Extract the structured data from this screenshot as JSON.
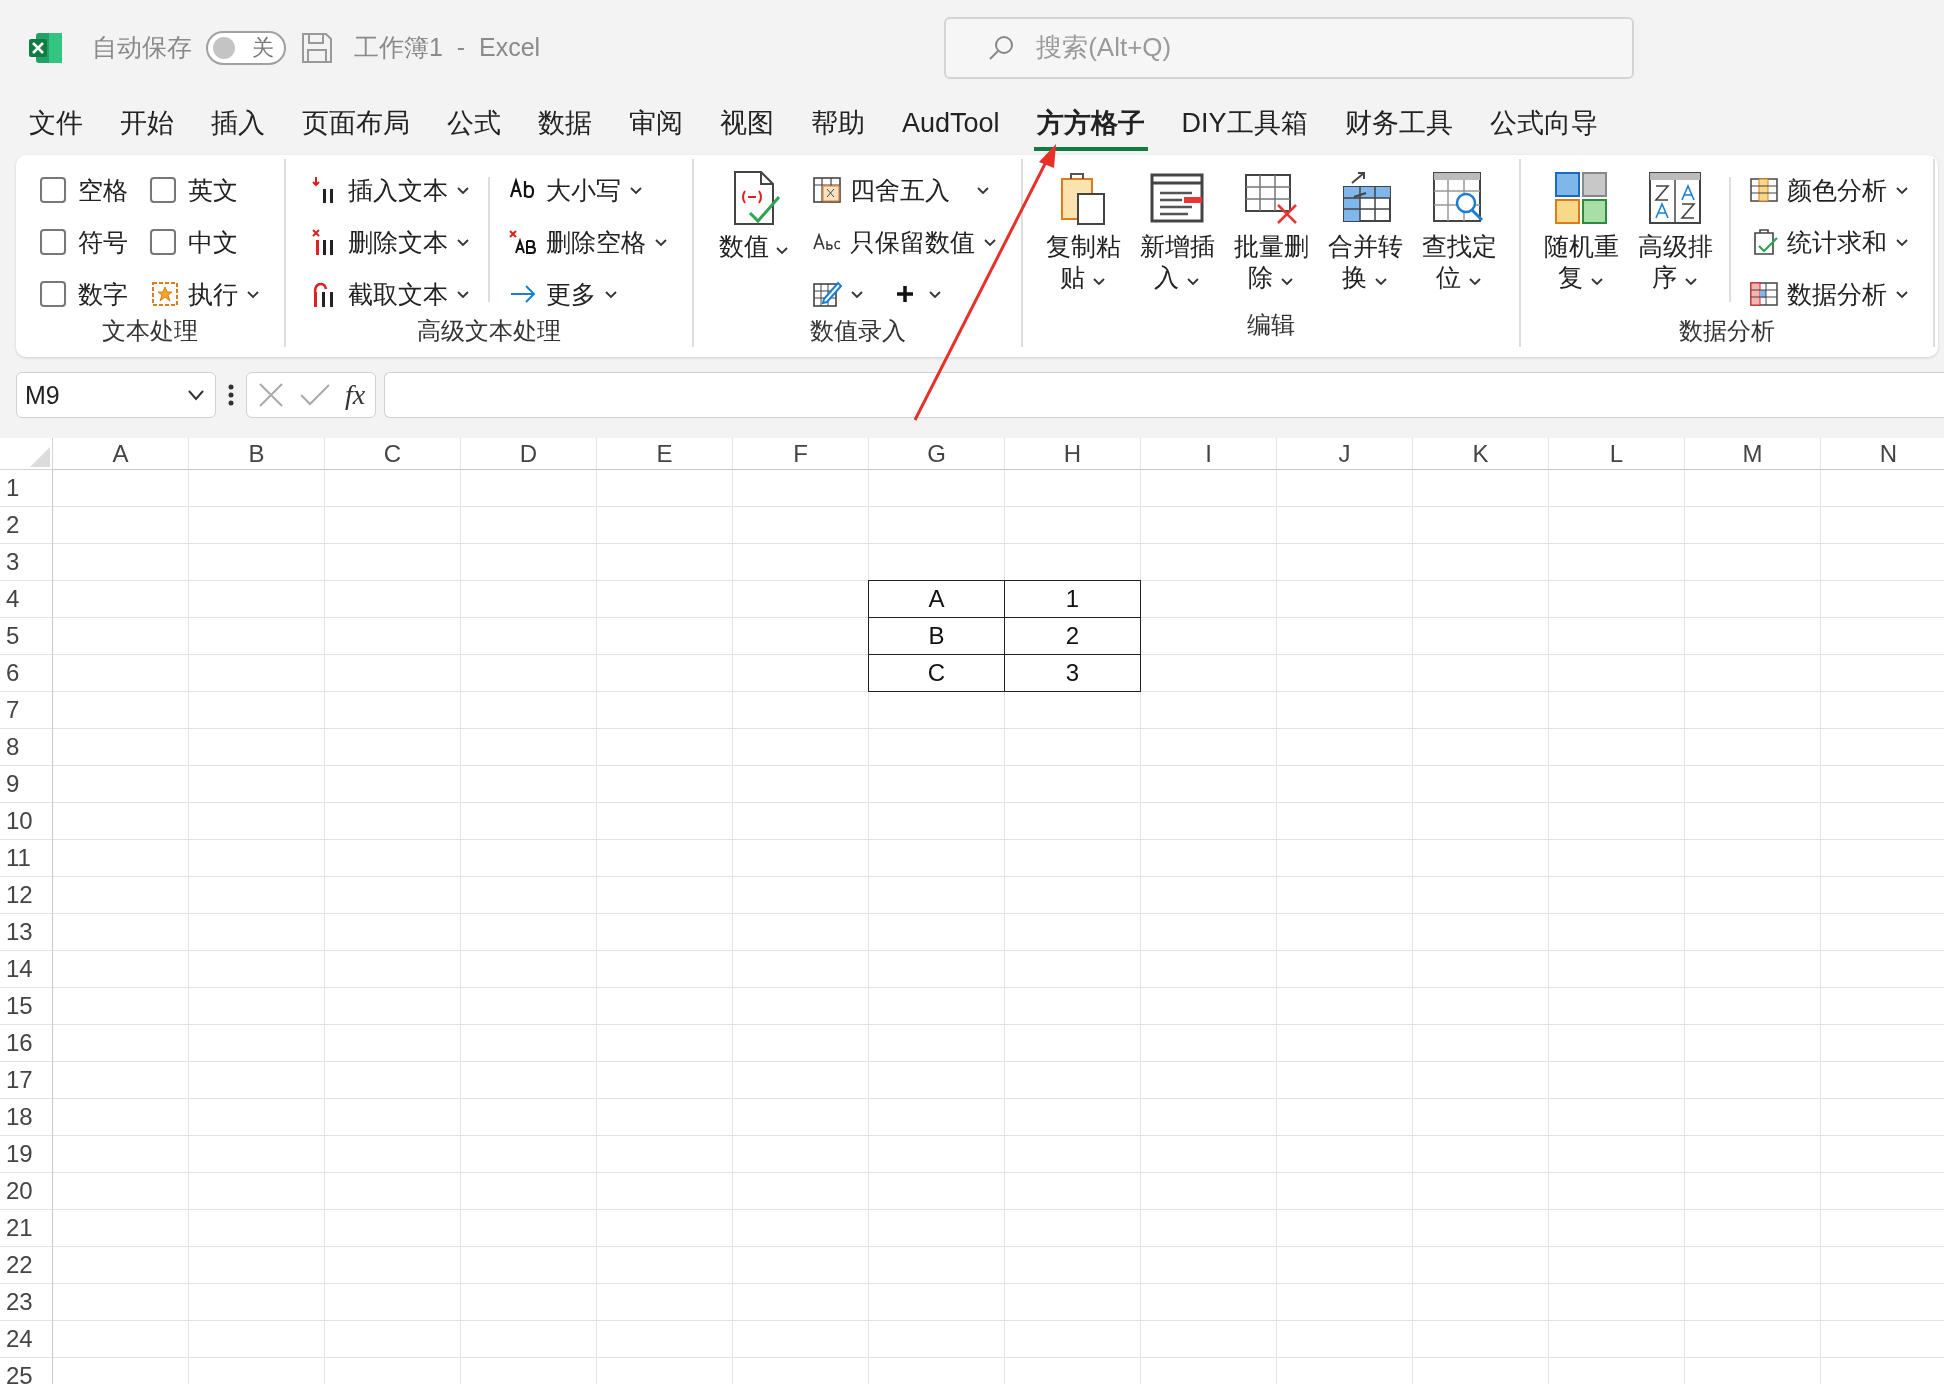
{
  "title_bar": {
    "autosave": {
      "label": "自动保存",
      "state_label": "关",
      "on": false
    },
    "title": "工作簿1  -  Excel",
    "search": {
      "placeholder": "搜索(Alt+Q)"
    }
  },
  "tabs": [
    {
      "label": "文件",
      "selected": false
    },
    {
      "label": "开始",
      "selected": false
    },
    {
      "label": "插入",
      "selected": false
    },
    {
      "label": "页面布局",
      "selected": false
    },
    {
      "label": "公式",
      "selected": false
    },
    {
      "label": "数据",
      "selected": false
    },
    {
      "label": "审阅",
      "selected": false
    },
    {
      "label": "视图",
      "selected": false
    },
    {
      "label": "帮助",
      "selected": false
    },
    {
      "label": "AudTool",
      "selected": false
    },
    {
      "label": "方方格子",
      "selected": true
    },
    {
      "label": "DIY工具箱",
      "selected": false
    },
    {
      "label": "财务工具",
      "selected": false
    },
    {
      "label": "公式向导",
      "selected": false
    }
  ],
  "ribbon": {
    "groups": [
      {
        "label": "文本处理",
        "columns": [
          {
            "kind": "stack",
            "items": [
              {
                "kind": "checkbox",
                "label": "空格",
                "checked": false
              },
              {
                "kind": "checkbox",
                "label": "符号",
                "checked": false
              },
              {
                "kind": "checkbox",
                "label": "数字",
                "checked": false
              }
            ]
          },
          {
            "kind": "stack",
            "items": [
              {
                "kind": "checkbox",
                "label": "英文",
                "checked": false
              },
              {
                "kind": "checkbox",
                "label": "中文",
                "checked": false
              },
              {
                "kind": "small",
                "label": "执行",
                "dropdown": true
              }
            ]
          }
        ]
      },
      {
        "label": "高级文本处理",
        "columns": [
          {
            "kind": "stack",
            "items": [
              {
                "kind": "small",
                "label": "插入文本",
                "dropdown": true
              },
              {
                "kind": "small",
                "label": "删除文本",
                "dropdown": true
              },
              {
                "kind": "small",
                "label": "截取文本",
                "dropdown": true
              }
            ]
          },
          {
            "kind": "divider"
          },
          {
            "kind": "stack",
            "items": [
              {
                "kind": "small",
                "label": "大小写",
                "dropdown": true
              },
              {
                "kind": "small",
                "label": "删除空格",
                "dropdown": true
              },
              {
                "kind": "small",
                "label": "更多",
                "dropdown": true
              }
            ]
          }
        ]
      },
      {
        "label": "数值录入",
        "columns": [
          {
            "kind": "stack",
            "items": [
              {
                "kind": "large",
                "label": "数值",
                "dropdown": true
              }
            ]
          },
          {
            "kind": "stack",
            "items": [
              {
                "kind": "small",
                "label": "四舍五入",
                "dropdown": true
              },
              {
                "kind": "small",
                "label": "只保留数值",
                "dropdown": true
              },
              {
                "kind": "pair",
                "items": [
                  {
                    "kind": "small",
                    "dropdown": true
                  },
                  {
                    "kind": "small",
                    "dropdown": true
                  }
                ]
              }
            ]
          }
        ]
      },
      {
        "label": "编辑",
        "columns": [
          {
            "kind": "stack",
            "items": [
              {
                "kind": "large",
                "label": "复制粘贴",
                "dropdown": true
              }
            ]
          },
          {
            "kind": "stack",
            "items": [
              {
                "kind": "large",
                "label": "新增插入",
                "dropdown": true
              }
            ]
          },
          {
            "kind": "stack",
            "items": [
              {
                "kind": "large",
                "label": "批量删除",
                "dropdown": true
              }
            ]
          },
          {
            "kind": "stack",
            "items": [
              {
                "kind": "large",
                "label": "合并转换",
                "dropdown": true
              }
            ]
          },
          {
            "kind": "stack",
            "items": [
              {
                "kind": "large",
                "label": "查找定位",
                "dropdown": true
              }
            ]
          }
        ]
      },
      {
        "label": "数据分析",
        "columns": [
          {
            "kind": "stack",
            "items": [
              {
                "kind": "large",
                "label": "随机重复",
                "dropdown": true
              }
            ]
          },
          {
            "kind": "stack",
            "items": [
              {
                "kind": "large",
                "label": "高级排序",
                "dropdown": true
              }
            ]
          },
          {
            "kind": "divider"
          },
          {
            "kind": "stack",
            "items": [
              {
                "kind": "small",
                "label": "颜色分析",
                "dropdown": true
              },
              {
                "kind": "small",
                "label": "统计求和",
                "dropdown": true
              },
              {
                "kind": "small",
                "label": "数据分析",
                "dropdown": true
              }
            ]
          }
        ]
      }
    ]
  },
  "formula_bar": {
    "name_box": "M9",
    "fx_label": "fx"
  },
  "sheet": {
    "columns": [
      "A",
      "B",
      "C",
      "D",
      "E",
      "F",
      "G",
      "H",
      "I",
      "J",
      "K",
      "L",
      "M",
      "N"
    ],
    "rows": [
      "1",
      "2",
      "3",
      "4",
      "5",
      "6",
      "7",
      "8",
      "9",
      "10",
      "11",
      "12",
      "13",
      "14",
      "15",
      "16",
      "17",
      "18",
      "19",
      "20",
      "21",
      "22",
      "23",
      "24",
      "25"
    ],
    "table": [
      [
        "A",
        "1"
      ],
      [
        "B",
        "2"
      ],
      [
        "C",
        "3"
      ]
    ]
  }
}
